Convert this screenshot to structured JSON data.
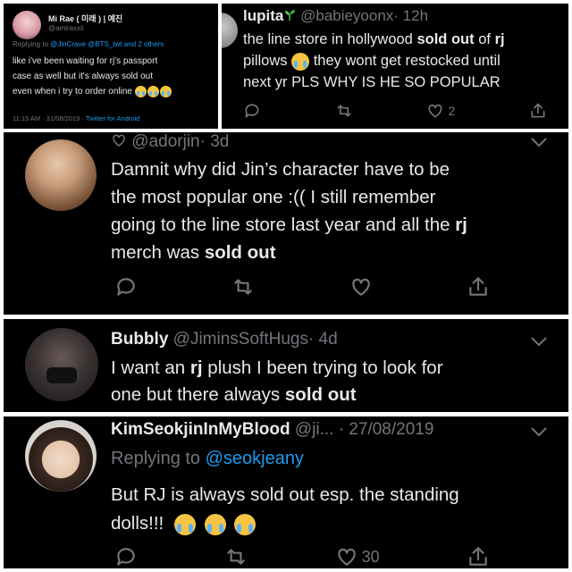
{
  "tweet1": {
    "name": "Mi Rae ( 미래 ) | 예진",
    "handle": "@amiraxxii",
    "reply_prefix": "Replying to",
    "reply_users": "@JinCrave @BTS_twt",
    "reply_suffix": "and 2 others",
    "line1": "like i've been waiting for rj's passport",
    "line2": "case as well but it's always sold out",
    "line3": "even when i try to order online",
    "time": "11:15 AM · 31/08/2019 ·",
    "client": "Twitter for Android",
    "emoji": "crying-emoji"
  },
  "tweet2": {
    "name": "lupita",
    "handle": "@babieyoonx",
    "time": "· 12h",
    "line1_a": "the line store in hollywood",
    "line1_b": "sold out",
    "line1_c": "of",
    "line1_d": "rj",
    "line2_a": "pillows",
    "line2_b": "they wont get restocked until",
    "line3": "next yr PLS WHY IS HE SO POPULAR",
    "like_count": "2",
    "name_icon": "sprout-icon"
  },
  "tweet3": {
    "handle": "@adorjin",
    "time": "· 3d",
    "line1": "Damnit why did Jin’s character have to be",
    "line2": "the most popular one :(( I still remember",
    "line3": "going to the line store last year and all the",
    "line3_b": "rj",
    "line4_a": "merch was",
    "line4_b": "sold out"
  },
  "tweet4": {
    "name": "Bubbly",
    "handle": "@JiminsSoftHugs",
    "time": "· 4d",
    "line1_a": "I want an",
    "line1_b": "rj",
    "line1_c": "plush I been trying to look for",
    "line2_a": "one but there always",
    "line2_b": "sold out"
  },
  "tweet5": {
    "name": "KimSeokjinInMyBlood",
    "handle": "@ji...",
    "time": "· 27/08/2019",
    "reply_prefix": "Replying to",
    "reply_user": "@seokjeany",
    "line1": "But RJ is always sold out esp. the standing",
    "line2": "dolls!!!",
    "like_count": "30"
  },
  "colors": {
    "background": "#000000",
    "text": "#e7e9ea",
    "muted": "#71767b",
    "link": "#1d9bf0"
  }
}
